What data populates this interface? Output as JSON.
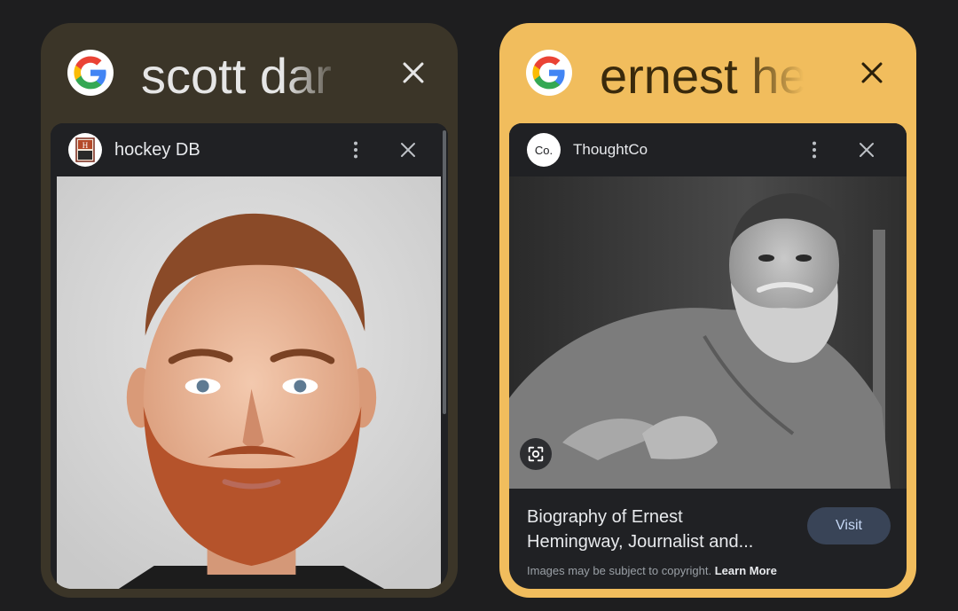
{
  "tabs": [
    {
      "title": "scott dar",
      "source": {
        "name": "hockey DB",
        "logo_letter": "H"
      },
      "icons": {
        "search": "google-g-icon",
        "close": "close-icon",
        "menu": "more-vert-icon"
      }
    },
    {
      "title": "ernest he",
      "source": {
        "name": "ThoughtCo",
        "logo_letter": "Co."
      },
      "result": {
        "caption_line1": "Biography of Ernest",
        "caption_line2": "Hemingway, Journalist and...",
        "visit_label": "Visit",
        "copyright_text": "Images may be subject to copyright.",
        "learn_more_label": "Learn More"
      },
      "icons": {
        "search": "google-g-icon",
        "close": "close-icon",
        "menu": "more-vert-icon",
        "lens": "lens-icon"
      }
    }
  ],
  "colors": {
    "background": "#1e1e1f",
    "tab_left": "#3b3528",
    "tab_right_active": "#f1bd5d",
    "panel": "#202124",
    "visit_button": "#394457"
  }
}
